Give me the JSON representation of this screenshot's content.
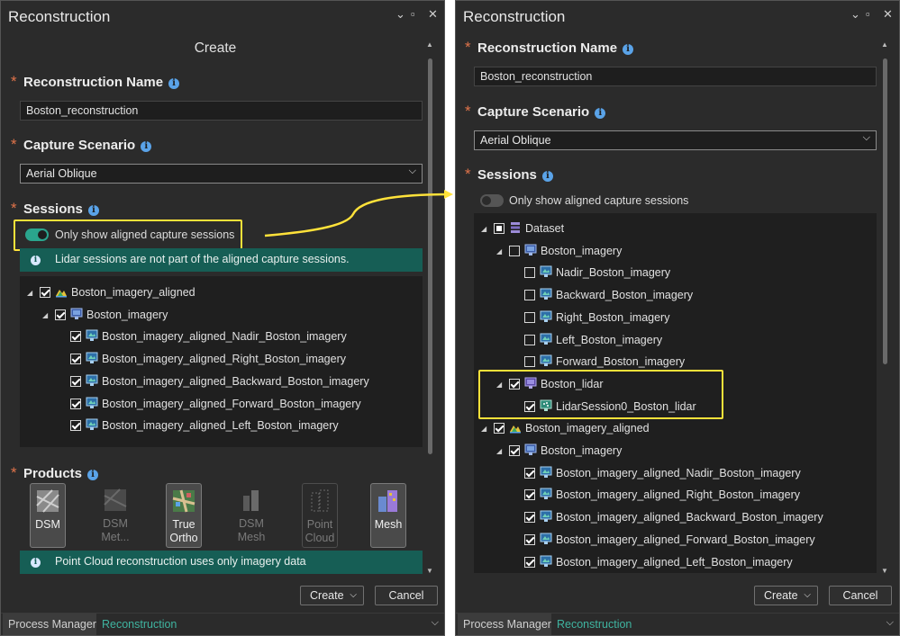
{
  "left": {
    "title": "Reconstruction",
    "heading": "Create",
    "controls": {
      "collapse": "⌄",
      "restore": "▫",
      "close": "✕"
    },
    "name_label": "Reconstruction Name",
    "name_value": "Boston_reconstruction",
    "scenario_label": "Capture Scenario",
    "scenario_value": "Aerial Oblique",
    "sessions_label": "Sessions",
    "toggle_label": "Only show aligned capture sessions",
    "toggle_on": true,
    "info_banner": "Lidar sessions are not part of the aligned capture sessions.",
    "tree": [
      {
        "label": "Boston_imagery_aligned",
        "level": 0,
        "expanded": true,
        "state": "checked",
        "icon": "aligned-dataset-icon"
      },
      {
        "label": "Boston_imagery",
        "level": 1,
        "expanded": true,
        "state": "checked",
        "icon": "imagery-collection-icon"
      },
      {
        "label": "Boston_imagery_aligned_Nadir_Boston_imagery",
        "level": 2,
        "state": "checked",
        "icon": "image-session-icon"
      },
      {
        "label": "Boston_imagery_aligned_Right_Boston_imagery",
        "level": 2,
        "state": "checked",
        "icon": "image-session-icon"
      },
      {
        "label": "Boston_imagery_aligned_Backward_Boston_imagery",
        "level": 2,
        "state": "checked",
        "icon": "image-session-icon"
      },
      {
        "label": "Boston_imagery_aligned_Forward_Boston_imagery",
        "level": 2,
        "state": "checked",
        "icon": "image-session-icon"
      },
      {
        "label": "Boston_imagery_aligned_Left_Boston_imagery",
        "level": 2,
        "state": "checked",
        "icon": "image-session-icon"
      }
    ],
    "products_label": "Products",
    "products": [
      {
        "line1": "DSM",
        "line2": "",
        "state": "selected",
        "icon": "dsm-icon"
      },
      {
        "line1": "DSM",
        "line2": "Met...",
        "state": "disabled",
        "icon": "dsm-metadata-icon"
      },
      {
        "line1": "True",
        "line2": "Ortho",
        "state": "selected",
        "icon": "true-ortho-icon"
      },
      {
        "line1": "DSM",
        "line2": "Mesh",
        "state": "disabled",
        "icon": "dsm-mesh-icon"
      },
      {
        "line1": "Point",
        "line2": "Cloud",
        "state": "disabled",
        "icon": "point-cloud-icon"
      },
      {
        "line1": "Mesh",
        "line2": "",
        "state": "selected",
        "icon": "mesh-icon"
      }
    ],
    "products_banner": "Point Cloud reconstruction uses only imagery data",
    "create_button": "Create",
    "cancel_button": "Cancel",
    "tabs": [
      "Process Manager",
      "Reconstruction"
    ]
  },
  "right": {
    "title": "Reconstruction",
    "controls": {
      "collapse": "⌄",
      "restore": "▫",
      "close": "✕"
    },
    "name_label": "Reconstruction Name",
    "name_value": "Boston_reconstruction",
    "scenario_label": "Capture Scenario",
    "scenario_value": "Aerial Oblique",
    "sessions_label": "Sessions",
    "toggle_label": "Only show aligned capture sessions",
    "toggle_on": false,
    "tree": [
      {
        "label": "Dataset",
        "level": 0,
        "expanded": true,
        "state": "partial",
        "icon": "dataset-icon"
      },
      {
        "label": "Boston_imagery",
        "level": 1,
        "expanded": true,
        "state": "unchecked",
        "icon": "imagery-collection-icon"
      },
      {
        "label": "Nadir_Boston_imagery",
        "level": 2,
        "state": "unchecked",
        "icon": "image-session-icon"
      },
      {
        "label": "Backward_Boston_imagery",
        "level": 2,
        "state": "unchecked",
        "icon": "image-session-icon"
      },
      {
        "label": "Right_Boston_imagery",
        "level": 2,
        "state": "unchecked",
        "icon": "image-session-icon"
      },
      {
        "label": "Left_Boston_imagery",
        "level": 2,
        "state": "unchecked",
        "icon": "image-session-icon"
      },
      {
        "label": "Forward_Boston_imagery",
        "level": 2,
        "state": "unchecked",
        "icon": "image-session-icon"
      },
      {
        "label": "Boston_lidar",
        "level": 1,
        "expanded": true,
        "state": "checked",
        "icon": "lidar-collection-icon"
      },
      {
        "label": "LidarSession0_Boston_lidar",
        "level": 2,
        "state": "checked",
        "icon": "lidar-session-icon"
      },
      {
        "label": "Boston_imagery_aligned",
        "level": 0,
        "expanded": true,
        "state": "checked",
        "icon": "aligned-dataset-icon"
      },
      {
        "label": "Boston_imagery",
        "level": 1,
        "expanded": true,
        "state": "checked",
        "icon": "imagery-collection-icon"
      },
      {
        "label": "Boston_imagery_aligned_Nadir_Boston_imagery",
        "level": 2,
        "state": "checked",
        "icon": "image-session-icon"
      },
      {
        "label": "Boston_imagery_aligned_Right_Boston_imagery",
        "level": 2,
        "state": "checked",
        "icon": "image-session-icon"
      },
      {
        "label": "Boston_imagery_aligned_Backward_Boston_imagery",
        "level": 2,
        "state": "checked",
        "icon": "image-session-icon"
      },
      {
        "label": "Boston_imagery_aligned_Forward_Boston_imagery",
        "level": 2,
        "state": "checked",
        "icon": "image-session-icon"
      },
      {
        "label": "Boston_imagery_aligned_Left_Boston_imagery",
        "level": 2,
        "state": "checked",
        "icon": "image-session-icon"
      }
    ],
    "create_button": "Create",
    "cancel_button": "Cancel",
    "tabs": [
      "Process Manager",
      "Reconstruction"
    ]
  },
  "colors": {
    "panel_bg": "#2b2b2b",
    "tree_bg": "#1f1f1f",
    "accent_teal": "#2aa58d",
    "banner_bg": "#165e55",
    "info_blue": "#5aa3e8",
    "required_orange": "#e0734a",
    "highlight_yellow": "#ffe23a"
  }
}
